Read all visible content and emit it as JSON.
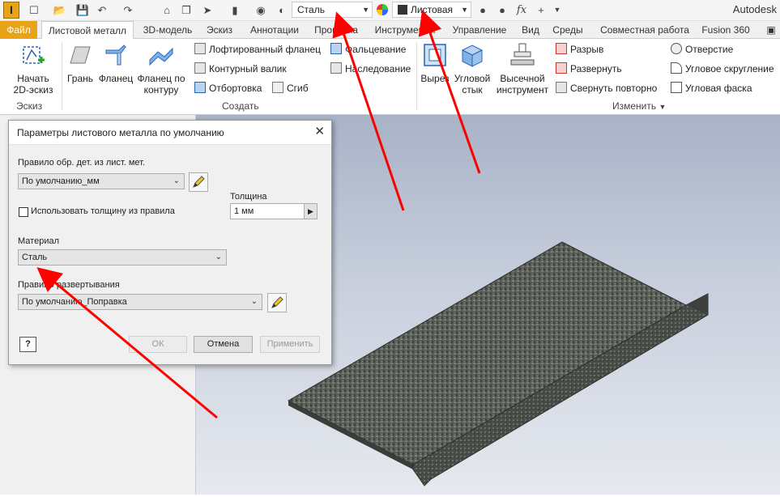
{
  "app": {
    "name": "Autodesk"
  },
  "qat": {
    "material_value": "Сталь",
    "appearance_value": "Листовая"
  },
  "tabs": [
    "Файл",
    "Листовой металл",
    "3D-модель",
    "Эскиз",
    "Аннотации",
    "Проверка",
    "Инструменты",
    "Управление",
    "Вид",
    "Среды",
    "Совместная работа",
    "Fusion 360"
  ],
  "ribbon": {
    "sketch_btn": "Начать 2D-эскиз",
    "sketch_btn_line1": "Начать",
    "sketch_btn_line2": "2D-эскиз",
    "sketch_group": "Эскиз",
    "face": "Грань",
    "flange": "Фланец",
    "contour_flange_1": "Фланец по",
    "contour_flange_2": "контуру",
    "lofted_flange": "Лофтированный фланец",
    "contour_roll": "Контурный валик",
    "hem": "Отбортовка",
    "fold": "Сгиб",
    "seam": "Фальцевание",
    "derive": "Наследование",
    "create_group": "Создать",
    "cut": "Вырез",
    "corner_seam_1": "Угловой",
    "corner_seam_2": "стык",
    "punch_1": "Высечной",
    "punch_2": "инструмент",
    "rip": "Разрыв",
    "unfold": "Развернуть",
    "refold": "Свернуть повторно",
    "hole": "Отверстие",
    "corner_round": "Угловое скругление",
    "corner_chamfer": "Угловая фаска",
    "modify_group": "Изменить"
  },
  "dialog": {
    "title": "Параметры листового металла по умолчанию",
    "rule_label": "Правило обр. дет. из лист. мет.",
    "rule_value": "По умолчанию_мм",
    "use_thickness_label": "Использовать толщину из правила",
    "use_thickness_checked": false,
    "thickness_label": "Толщина",
    "thickness_value": "1 мм",
    "material_label": "Материал",
    "material_value": "Сталь",
    "unfold_rule_label": "Правило развертывания",
    "unfold_rule_value": "По умолчанию_Поправка",
    "ok": "ОК",
    "cancel": "Отмена",
    "apply": "Применить",
    "help": "?"
  },
  "colors": {
    "file_tab": "#e8a317",
    "annotation_arrow": "#ff0000",
    "viewport_top": "#a9b3c7"
  }
}
